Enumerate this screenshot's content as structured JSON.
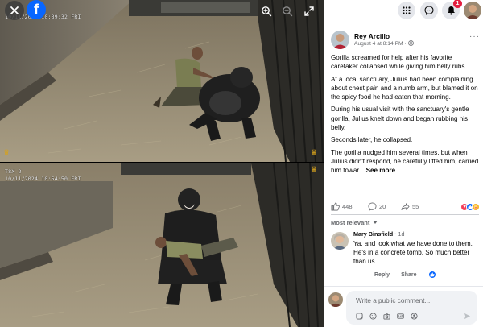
{
  "viewer": {
    "frame_top": {
      "camera_line1": "10/11/2024  10:39:32 FRI"
    },
    "frame_bottom": {
      "camera_line1": "T8X 2",
      "camera_line2": "10/11/2024  10:54:50 FRI"
    },
    "close_icon": "close-icon",
    "brand_icon": "facebook-logo",
    "brand_letter": "f",
    "tools": [
      "zoom-in-icon",
      "zoom-out-icon",
      "fullscreen-icon"
    ],
    "colors": {
      "brand": "#0866ff",
      "crown": "#d6a21e"
    }
  },
  "topbar": {
    "icons": [
      "grid-menu-icon",
      "messenger-icon",
      "bell-icon",
      "account-avatar"
    ],
    "notification_count": "1"
  },
  "post": {
    "author": "Rey Arcillo",
    "date": "August 4 at 8:14 PM",
    "date_separator": "·",
    "audience_icon": "globe-icon",
    "more_icon": "more-icon",
    "more_glyph": "···",
    "paragraphs": [
      "Gorilla screamed for help after his favorite caretaker collapsed while giving him belly rubs.",
      "At a local sanctuary, Julius had been complaining about chest pain and a numb arm, but blamed it on the spicy food he had eaten that morning.",
      "During his usual visit with the sanctuary's gentle gorilla, Julius knelt down and began rubbing his belly.",
      "Seconds later, he collapsed."
    ],
    "last_paragraph": "The gorilla nudged him several times, but when Julius didn't respond, he carefully lifted him, carried him towar...",
    "see_more": "See more"
  },
  "reactions": {
    "likes": "448",
    "comments": "20",
    "shares": "55",
    "emoji_icons": [
      "love-icon",
      "like-icon",
      "care-icon"
    ],
    "colors": {
      "love": "#f33e58",
      "like": "#0866ff",
      "care": "#f7b125"
    }
  },
  "comments_section": {
    "sort_label": "Most relevant",
    "comment": {
      "name": "Mary Binsfield",
      "time": "1d",
      "text": "Ya, and look what we have done to them. He's in a concrete tomb. So much better than us.",
      "reply_label": "Reply",
      "share_label": "Share"
    }
  },
  "composer": {
    "placeholder": "Write a public comment...",
    "icons": [
      "sticker-icon",
      "emoji-icon",
      "camera-icon",
      "gif-icon",
      "avatar-sticker-icon"
    ],
    "send_icon": "send-icon"
  }
}
